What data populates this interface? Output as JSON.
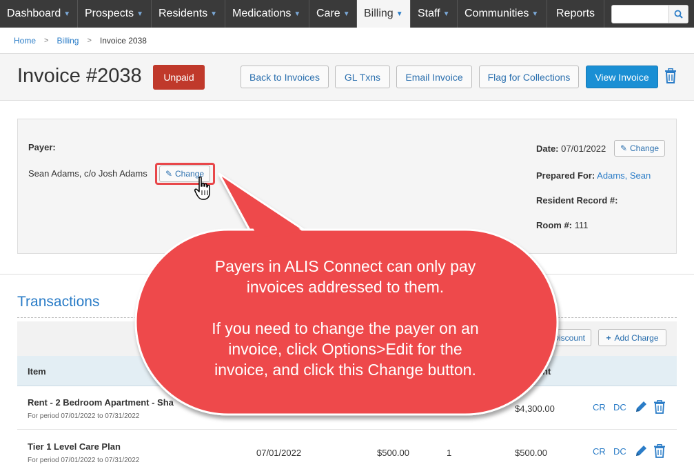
{
  "nav": {
    "items": [
      "Dashboard",
      "Prospects",
      "Residents",
      "Medications",
      "Care",
      "Billing",
      "Staff",
      "Communities",
      "Reports"
    ],
    "active": "Billing",
    "search_placeholder": ""
  },
  "breadcrumb": {
    "home": "Home",
    "billing": "Billing",
    "current": "Invoice 2038"
  },
  "header": {
    "title": "Invoice #2038",
    "status": "Unpaid",
    "back_label": "Back to Invoices",
    "gl_label": "GL Txns",
    "email_label": "Email Invoice",
    "flag_label": "Flag for Collections",
    "view_label": "View Invoice"
  },
  "payer": {
    "label": "Payer:",
    "name": "Sean Adams, c/o Josh Adams",
    "change_label": "Change"
  },
  "details": {
    "date_label": "Date:",
    "date_value": "07/01/2022",
    "change_label": "Change",
    "prepared_label": "Prepared For:",
    "prepared_value": "Adams, Sean",
    "resident_record_label": "Resident Record #:",
    "room_label": "Room #:",
    "room_value": "111"
  },
  "transactions": {
    "title": "Transactions",
    "discount_label": "Discount",
    "add_charge_label": "Add Charge",
    "col_item": "Item",
    "col_amount": "nt",
    "rows": [
      {
        "item": "Rent - 2 Bedroom Apartment - Sha",
        "period": "For period 07/01/2022 to 07/31/2022",
        "date": "",
        "price": "",
        "qty": "",
        "amount": "$4,300.00",
        "cr": "CR",
        "dc": "DC"
      },
      {
        "item": "Tier 1 Level Care Plan",
        "period": "For period 07/01/2022 to 07/31/2022",
        "date": "07/01/2022",
        "price": "$500.00",
        "qty": "1",
        "amount": "$500.00",
        "cr": "CR",
        "dc": "DC"
      }
    ]
  },
  "callout": {
    "line1": "Payers in ALIS Connect can only pay",
    "line2": "invoices addressed to them.",
    "line3": "If you need to change the payer on an",
    "line4": "invoice, click Options>Edit for the",
    "line5": "invoice, and click this Change button."
  },
  "colors": {
    "nav_bg": "#3a3a3a",
    "accent": "#2a7cc7",
    "unpaid": "#c0392b",
    "primary_btn": "#1a8fd4",
    "callout": "#e8474a"
  }
}
